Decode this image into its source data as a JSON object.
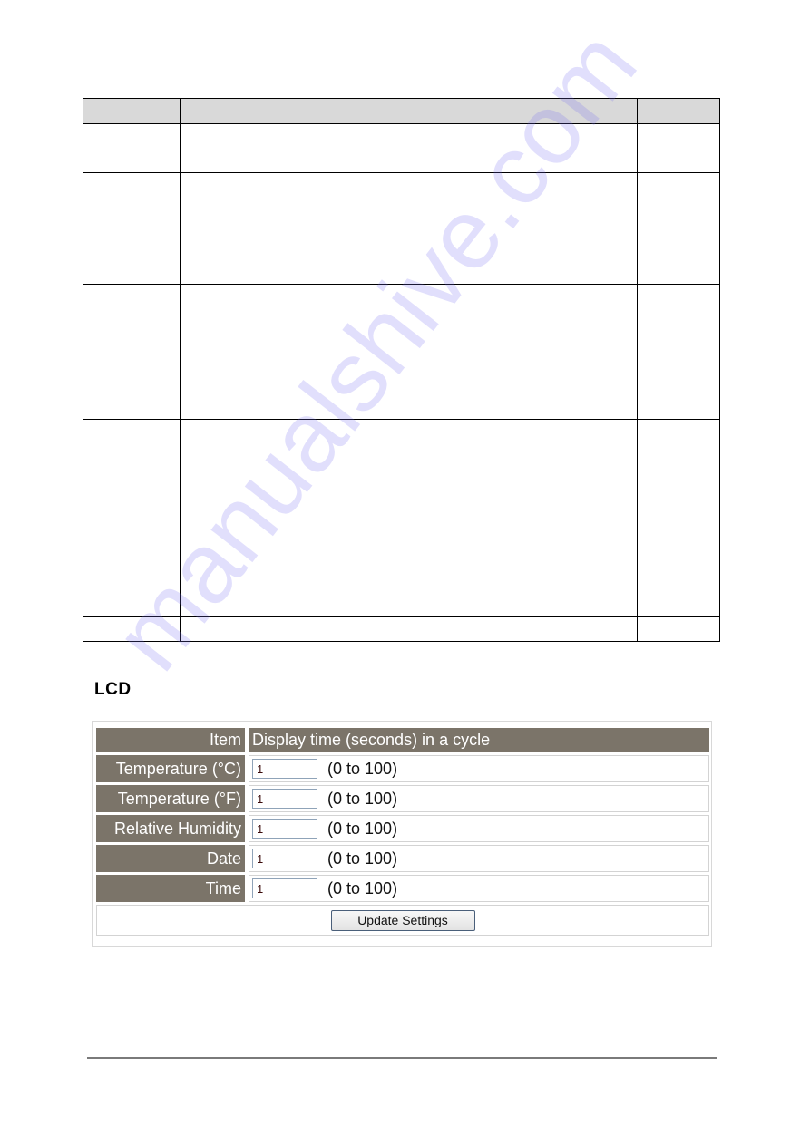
{
  "spec_table": {
    "header": [
      "",
      "",
      ""
    ],
    "rows": [
      [
        "",
        "",
        ""
      ],
      [
        "",
        "",
        ""
      ],
      [
        "",
        "",
        ""
      ],
      [
        "",
        "",
        ""
      ],
      [
        "",
        "",
        ""
      ],
      [
        "",
        "",
        ""
      ]
    ]
  },
  "lcd": {
    "heading": "LCD",
    "header": {
      "item_label": "Item",
      "value_label": "Display time (seconds) in a cycle"
    },
    "rows": [
      {
        "label": "Temperature (°C)",
        "value": "1",
        "range": "(0 to 100)"
      },
      {
        "label": "Temperature (°F)",
        "value": "1",
        "range": "(0 to 100)"
      },
      {
        "label": "Relative Humidity",
        "value": "1",
        "range": "(0 to 100)"
      },
      {
        "label": "Date",
        "value": "1",
        "range": "(0 to 100)"
      },
      {
        "label": "Time",
        "value": "1",
        "range": "(0 to 100)"
      }
    ],
    "update_button": "Update Settings"
  },
  "watermark": "manualshive.com",
  "colors": {
    "label_bg": "#7b7469",
    "table_header_bg": "#d9d9d9",
    "input_border": "#8fa3b8"
  }
}
